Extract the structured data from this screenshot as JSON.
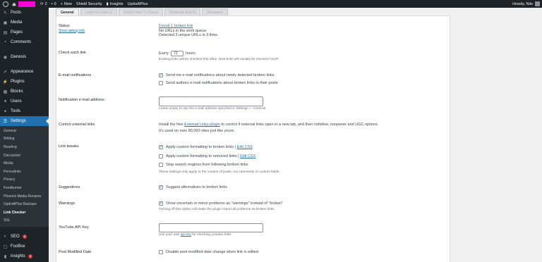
{
  "admin_bar": {
    "comments_count": "2",
    "updates_count": "0",
    "new_label": "New",
    "shield_label": "Shield Security",
    "insights_label": "Insights",
    "updraft_label": "UpdraftPlus",
    "howdy": "Howdy, Nile"
  },
  "sidebar": {
    "top_items": [
      {
        "label": "Posts",
        "icon": "pin-icon"
      },
      {
        "label": "Media",
        "icon": "media-icon"
      },
      {
        "label": "Pages",
        "icon": "pages-icon"
      },
      {
        "label": "Comments",
        "icon": "comments-icon"
      }
    ],
    "genesis": "Genesis",
    "mid_items": [
      {
        "label": "Appearance"
      },
      {
        "label": "Plugins"
      },
      {
        "label": "Blocks"
      },
      {
        "label": "Users"
      },
      {
        "label": "Tools"
      },
      {
        "label": "Settings"
      }
    ],
    "submenu": [
      "General",
      "Writing",
      "Reading",
      "Discussion",
      "Media",
      "Permalinks",
      "Privacy",
      "Feedburner",
      "Phoenix Media Rename",
      "UpdraftPlus Backups",
      "Link Checker",
      "SSL"
    ],
    "bottom_items": [
      {
        "label": "SEO",
        "badge": "1"
      },
      {
        "label": "FooBox"
      },
      {
        "label": "Insights",
        "badge": "1"
      }
    ]
  },
  "tabs": [
    "General",
    "Look For Links In",
    "Which Links To Check",
    "Protocols & APIs",
    "Advanced"
  ],
  "form": {
    "status": {
      "label": "Status",
      "debug_link": "Show debug info",
      "found_link": "Found 1 broken link",
      "queue": "No URLs in the work queue.",
      "detected": "Detected 3 unique URLs in 3 links."
    },
    "check_each_link": {
      "label": "Check each link",
      "every": "Every",
      "value": "72",
      "hours": "hours",
      "desc": "Existing links will be checked this often. New links will usually be checked ASAP."
    },
    "email_notifications": {
      "label": "E-mail notifications",
      "opt1": "Send me e-mail notifications about newly detected broken links",
      "opt2": "Send authors e-mail notifications about broken links in their posts"
    },
    "notification_email": {
      "label": "Notification e-mail address",
      "value": "",
      "desc": "Leave empty to use the e-mail address specified in Settings — General."
    },
    "external_links": {
      "label": "Control external links",
      "line1_pre": "Install the free",
      "line1_link": "External Links plugin",
      "line1_post": "to control if external links open in a new tab, and their nofollow, noopener and UGC options.",
      "line2": "It's used on over 80,000 sites just like yours."
    },
    "link_tweaks": {
      "label": "Link tweaks",
      "opt1": "Apply custom formatting to broken links |",
      "opt1_link": "Edit CSS",
      "opt2": "Apply custom formatting to removed links |",
      "opt2_link": "Edit CSS",
      "opt3": "Stop search engines from following broken links",
      "desc": "These settings only apply to the content of posts, not comments or custom fields."
    },
    "suggestions": {
      "label": "Suggestions",
      "opt": "Suggest alternatives to broken links"
    },
    "warnings": {
      "label": "Warnings",
      "opt": "Show uncertain or minor problems as \"warnings\" instead of \"broken\"",
      "desc": "Turning off this option will make the plugin report all problems as broken links."
    },
    "youtube": {
      "label": "YouTube API Key",
      "value": "",
      "desc_pre": "Use your own",
      "desc_link": "api key",
      "desc_post": "for checking youtube links."
    },
    "post_modified": {
      "label": "Post Modified Date",
      "opt": "Disable post modified date change when link is edited"
    }
  }
}
